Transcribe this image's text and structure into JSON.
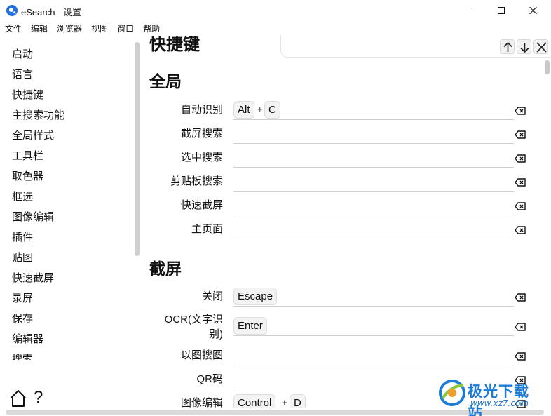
{
  "window": {
    "title": "eSearch - 设置"
  },
  "menubar": [
    "文件",
    "编辑",
    "浏览器",
    "视图",
    "窗口",
    "帮助"
  ],
  "sidebar": {
    "items": [
      "启动",
      "语言",
      "快捷键",
      "主搜索功能",
      "全局样式",
      "工具栏",
      "取色器",
      "框选",
      "图像编辑",
      "插件",
      "贴图",
      "快速截屏",
      "录屏",
      "保存",
      "编辑器",
      "搜索"
    ],
    "help_label": "?"
  },
  "main": {
    "top_heading": "快捷键",
    "sections": [
      {
        "heading": "全局",
        "rows": [
          {
            "label": "自动识别",
            "keys": [
              "Alt",
              "C"
            ]
          },
          {
            "label": "截屏搜索",
            "keys": []
          },
          {
            "label": "选中搜索",
            "keys": []
          },
          {
            "label": "剪贴板搜索",
            "keys": []
          },
          {
            "label": "快速截屏",
            "keys": []
          },
          {
            "label": "主页面",
            "keys": []
          }
        ]
      },
      {
        "heading": "截屏",
        "rows": [
          {
            "label": "关闭",
            "keys": [
              "Escape"
            ]
          },
          {
            "label": "OCR(文字识别)",
            "label_lines": [
              "OCR(文字识",
              "别)"
            ],
            "keys": [
              "Enter"
            ]
          },
          {
            "label": "以图搜图",
            "keys": []
          },
          {
            "label": "QR码",
            "keys": []
          },
          {
            "label": "图像编辑",
            "keys": [
              "Control",
              "D"
            ]
          }
        ]
      }
    ],
    "key_separator": "+"
  },
  "search_panel": {
    "buttons": [
      "up-arrow-icon",
      "down-arrow-icon",
      "close-icon"
    ]
  },
  "watermark": {
    "name": "极光下载站",
    "url": "www.xz7.com"
  },
  "colors": {
    "accent": "#1e6fe0",
    "watermark": "#1b7bd6"
  }
}
